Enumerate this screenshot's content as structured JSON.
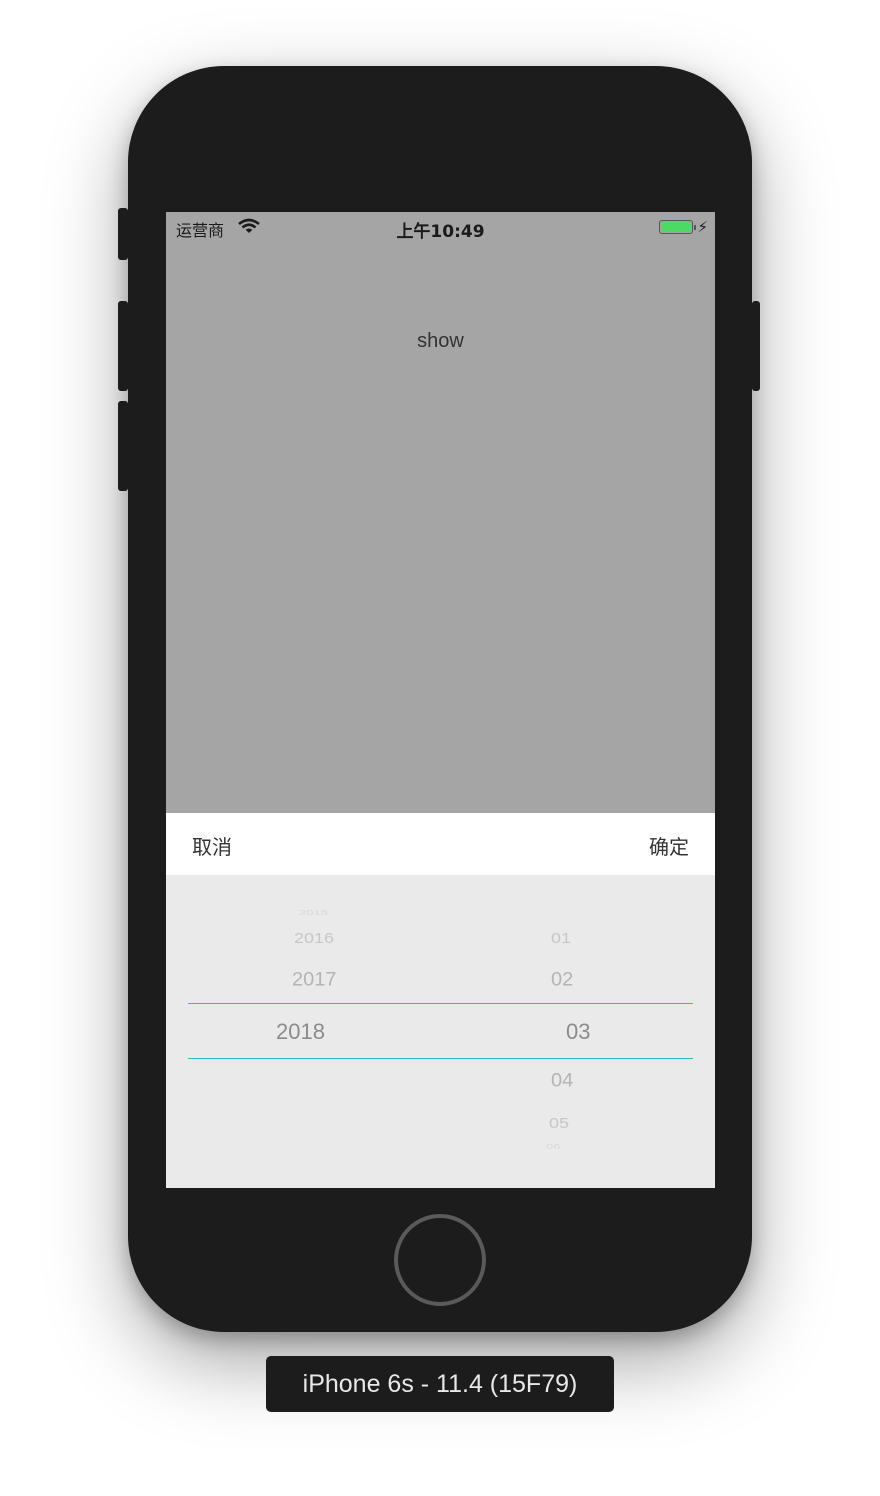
{
  "device": {
    "label": "iPhone 6s - 11.4 (15F79)"
  },
  "status_bar": {
    "carrier": "运营商",
    "time": "上午10:49",
    "wifi_icon": "wifi-icon",
    "battery_icon": "battery-charging-icon"
  },
  "main": {
    "show_label": "show"
  },
  "toolbar": {
    "cancel_label": "取消",
    "confirm_label": "确定"
  },
  "picker": {
    "years": [
      "2015",
      "2016",
      "2017",
      "2018"
    ],
    "selected_year": "2018",
    "months": [
      "01",
      "02",
      "03",
      "04",
      "05",
      "06"
    ],
    "selected_month": "03",
    "selection_line_color": "#3ab7c5"
  },
  "colors": {
    "screen_background": "#a5a5a5",
    "picker_background": "#eaeaea",
    "battery": "#4cd964"
  }
}
